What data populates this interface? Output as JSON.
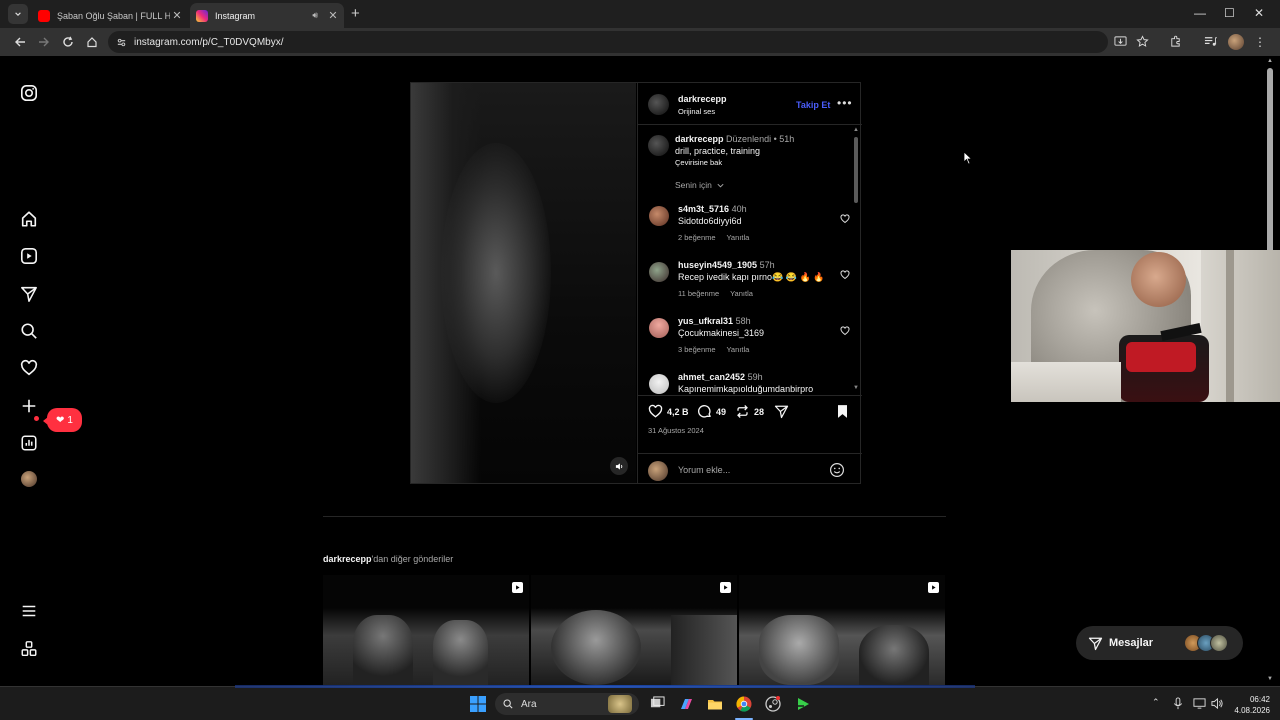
{
  "browser": {
    "tabs": [
      {
        "title": "Şaban Oğlu Şaban | FULL HD - Y",
        "active": false,
        "favicon": "youtube-icon"
      },
      {
        "title": "Instagram",
        "active": true,
        "favicon": "instagram-icon"
      }
    ],
    "new_tab": "+",
    "url": "instagram.com/p/C_T0DVQMbyx/"
  },
  "sidebar": {
    "items": [
      "instagram-logo",
      "home-icon",
      "reels-icon",
      "messages-icon",
      "search-icon",
      "notifications-icon",
      "create-icon",
      "dashboard-icon",
      "profile-avatar",
      "menu-icon",
      "threads-icon"
    ],
    "notification_count": "1"
  },
  "post": {
    "author": "darkrecepp",
    "audio": "Orijinal ses",
    "follow_label": "Takip Et",
    "caption": {
      "user": "darkrecepp",
      "edited": "Düzenlendi",
      "time": "51h",
      "text": "drill, practice, training",
      "translate": "Çevirisine bak"
    },
    "sort_label": "Senin için",
    "comments": [
      {
        "user": "s4m3t_5716",
        "time": "40h",
        "text": "Sidotdo6diyyi6d",
        "likes": "2 beğenme",
        "reply": "Yanıtla"
      },
      {
        "user": "huseyin4549_1905",
        "time": "57h",
        "text": "Recep ivedik kapı pırno😂 😂 🔥 🔥",
        "likes": "11 beğenme",
        "reply": "Yanıtla"
      },
      {
        "user": "yus_ufkral31",
        "time": "58h",
        "text": "Çocukmakinesi_3169",
        "likes": "3 beğenme",
        "reply": "Yanıtla"
      },
      {
        "user": "ahmet_can2452",
        "time": "59h",
        "text": "Kapınemimkapıolduğumdanbirpro",
        "likes": "",
        "reply": ""
      }
    ],
    "likes": "4,2 B",
    "comment_count": "49",
    "reposts": "28",
    "date": "31 Ağustos 2024",
    "add_comment_placeholder": "Yorum ekle..."
  },
  "more_posts": {
    "user": "darkrecepp",
    "suffix": "'dan diğer gönderiler"
  },
  "messages": {
    "label": "Mesajlar"
  },
  "taskbar": {
    "search_placeholder": "Ara",
    "time": "06:42",
    "date": "4.08.2026"
  },
  "colors": {
    "accent_blue": "#4a5df9",
    "notification_red": "#ff3040",
    "background": "#000000"
  }
}
